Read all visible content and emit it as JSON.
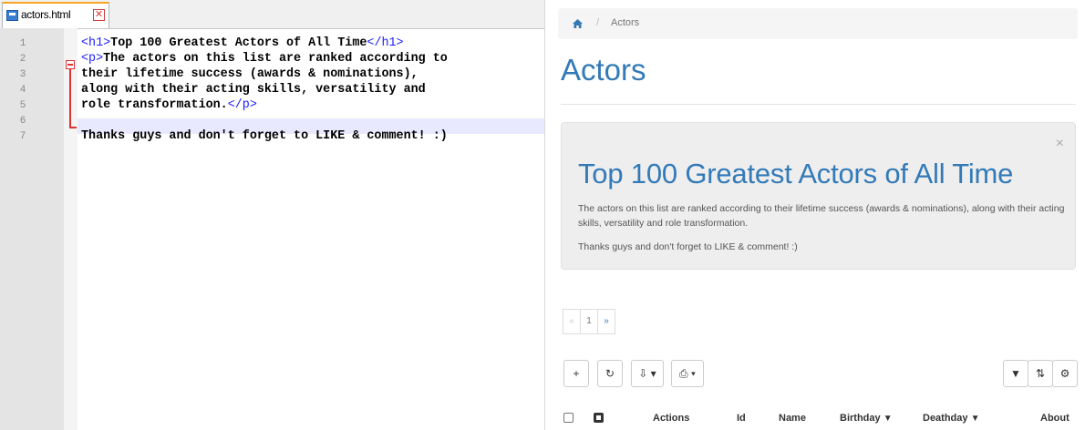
{
  "editor": {
    "tab_label": "actors.html",
    "tab_close": "✕",
    "line_numbers": [
      "1",
      "2",
      "3",
      "4",
      "5",
      "6",
      "7"
    ],
    "lines": [
      {
        "tag_open": "<h1>",
        "text": "Top 100 Greatest Actors of All Time",
        "tag_close": "</h1>"
      },
      {
        "tag_open": "<p>",
        "text": "The actors on this list are ranked according to",
        "tag_close": ""
      },
      {
        "tag_open": "",
        "text": "their lifetime success (awards & nominations),",
        "tag_close": ""
      },
      {
        "tag_open": "",
        "text": "along with their acting skills, versatility and",
        "tag_close": ""
      },
      {
        "tag_open": "",
        "text": "role transformation.",
        "tag_close": "</p>"
      },
      {
        "tag_open": "",
        "text": "",
        "tag_close": ""
      },
      {
        "tag_open": "",
        "text": "Thanks guys and don't forget to LIKE & comment! :)",
        "tag_close": ""
      }
    ]
  },
  "web": {
    "breadcrumb": {
      "separator": "/",
      "current": "Actors"
    },
    "page_title": "Actors",
    "jumbotron": {
      "close": "×",
      "title": "Top 100 Greatest Actors of All Time",
      "paragraph": "The actors on this list are ranked according to their lifetime success (awards & nominations), along with their acting skills, versatility and role transformation.",
      "thanks": "Thanks guys and don't forget to LIKE & comment! :)"
    },
    "pager": {
      "prev": "«",
      "page": "1",
      "next": "»"
    },
    "toolbar": {
      "add": "+",
      "refresh": "↻",
      "export": "⇩ ▾",
      "print": "⎙ ▾",
      "filter": "▼",
      "sort": "⇅",
      "settings": "⚙"
    },
    "columns": [
      "Actions",
      "Id",
      "Name",
      "Birthday",
      "Deathday",
      "About"
    ],
    "filter_glyph": "▼"
  }
}
